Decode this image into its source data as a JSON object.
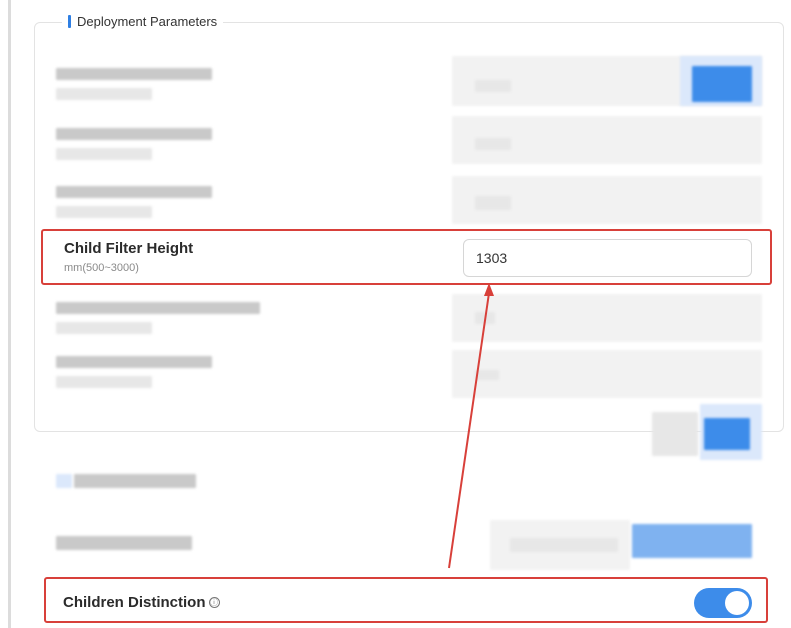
{
  "section": {
    "title": "Deployment Parameters"
  },
  "child_filter_height": {
    "label": "Child Filter Height",
    "hint": "mm(500~3000)",
    "value": "1303"
  },
  "children_distinction": {
    "label": "Children Distinction",
    "info_icon": "ⓘ",
    "toggle_on": true
  },
  "colors": {
    "accent": "#3d8cea",
    "highlight": "#d8403a"
  }
}
